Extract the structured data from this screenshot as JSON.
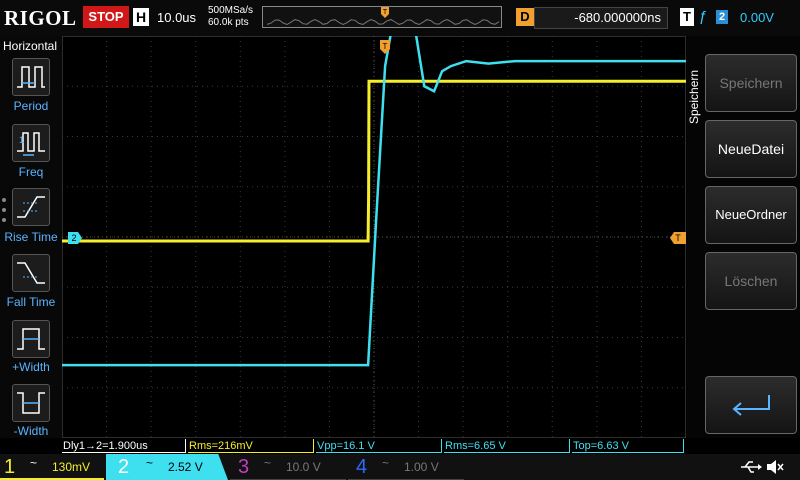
{
  "brand": "RIGOL",
  "run_state": "STOP",
  "timebase": {
    "label": "H",
    "value": "10.0us"
  },
  "sample_rate": "500MSa/s",
  "mem_depth": "60.0k pts",
  "trigger_position_marker": "T",
  "delay": {
    "label": "D",
    "value": "-680.000000ns"
  },
  "trigger": {
    "label": "T",
    "edge_symbol": "ƒ",
    "source": "2",
    "level": "0.00V"
  },
  "left_menu": {
    "title": "Horizontal",
    "items": [
      {
        "label": "Period",
        "icon": "period-icon"
      },
      {
        "label": "Freq",
        "icon": "freq-icon"
      },
      {
        "label": "Rise Time",
        "icon": "rise-time-icon"
      },
      {
        "label": "Fall Time",
        "icon": "fall-time-icon"
      },
      {
        "label": "+Width",
        "icon": "positive-width-icon"
      },
      {
        "label": "-Width",
        "icon": "negative-width-icon"
      }
    ]
  },
  "right_menu": {
    "title": "Speichern",
    "buttons": [
      {
        "label": "Speichern",
        "enabled": false
      },
      {
        "label": "NeueDatei",
        "enabled": true
      },
      {
        "label": "NeueOrdner",
        "enabled": true
      },
      {
        "label": "Löschen",
        "enabled": false
      },
      {
        "label": "",
        "icon": "enter-return-icon",
        "enabled": true
      }
    ]
  },
  "measurements": [
    {
      "text": "Dly1→2=1.900us",
      "color": "#ffffff"
    },
    {
      "text": "Rms=216mV",
      "color": "#f5ee2c"
    },
    {
      "text": "Vpp=16.1 V",
      "color": "#3ee0f0"
    },
    {
      "text": "Rms=6.65 V",
      "color": "#3ee0f0"
    },
    {
      "text": "Top=6.63 V",
      "color": "#3ee0f0"
    }
  ],
  "channels": [
    {
      "num": "1",
      "coupling": "~",
      "scale": "130mV",
      "color": "#f5ee2c",
      "active": true
    },
    {
      "num": "2",
      "coupling": "~",
      "scale": "2.52 V",
      "color": "#3ee0f0",
      "active": true
    },
    {
      "num": "3",
      "coupling": "~",
      "scale": "10.0 V",
      "color": "#c03cc0",
      "active": false
    },
    {
      "num": "4",
      "coupling": "~",
      "scale": "1.00 V",
      "color": "#2a6cff",
      "active": false
    }
  ],
  "channel_markers": {
    "ch2_ground": "2"
  },
  "colors": {
    "ch1": "#f5ee2c",
    "ch2": "#3ee0f0",
    "trigger": "#f0a030",
    "grid": "#3a3a3a"
  },
  "chart_data": {
    "type": "line",
    "x_unit": "us",
    "x_range": [
      -70.68,
      69.32
    ],
    "y_divisions": [
      -4,
      4
    ],
    "series": [
      {
        "name": "1",
        "x": [
          -70.68,
          -2.0,
          -1.9,
          -1.8,
          -1.0,
          0.5,
          69.32
        ],
        "y": [
          -0.08,
          -0.08,
          0.8,
          3.1,
          3.1,
          3.1,
          3.1
        ]
      },
      {
        "name": "2",
        "x": [
          -70.68,
          -2.0,
          -0.1,
          1.8,
          3.8,
          6.2,
          8.6,
          10.6,
          12.8,
          14.6,
          16.6,
          20.0,
          25.0,
          31.0,
          40.0,
          69.32
        ],
        "y": [
          -2.55,
          -2.55,
          0.5,
          3.4,
          4.4,
          4.9,
          4.1,
          3.0,
          2.9,
          3.3,
          3.4,
          3.5,
          3.45,
          3.5,
          3.5,
          3.5
        ]
      }
    ]
  }
}
